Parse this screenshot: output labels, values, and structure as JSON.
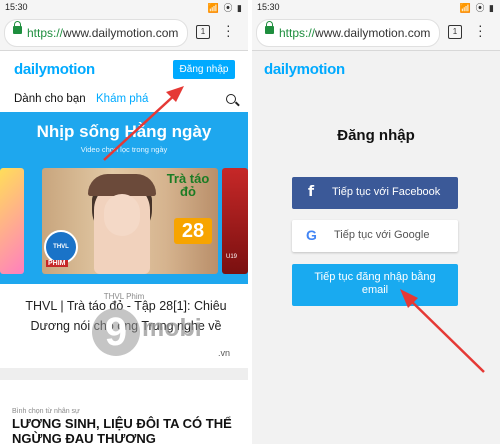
{
  "left": {
    "status": {
      "time": "15:30",
      "icons": "📶 ⦿ ▮"
    },
    "browser": {
      "url_proto": "https://",
      "url_rest": "www.dailymotion.com",
      "tab_count": "1"
    },
    "header": {
      "logo": "dailymotion",
      "login_label": "Đăng nhập"
    },
    "tabs": [
      "Dành cho bạn",
      "Khám phá"
    ],
    "hero": {
      "title": "Nhịp sống Hằng ngày",
      "subtitle": "Video chọn lọc trong ngày",
      "card_badge": "Trà táo đỏ",
      "card_number": "28",
      "channel_logo": "THVL",
      "channel_label": "PHIM",
      "side_label": "U19"
    },
    "video": {
      "channel": "THVL Phim",
      "title": "THVL | Trà táo đỏ - Tập 28[1]: Chiêu Dương nói cho ông Trung nghe về"
    },
    "article": {
      "category": "Bình chọn từ nhân sự",
      "title": "LƯƠNG SINH, LIỆU ĐÔI TA CÓ THỂ NGỪNG ĐAU THƯƠNG"
    },
    "watermark": {
      "digit": "9",
      "text": "mobi",
      "suffix": ".vn"
    }
  },
  "right": {
    "status": {
      "time": "15:30",
      "icons": "📶 ⦿ ▮"
    },
    "browser": {
      "url_proto": "https://",
      "url_rest": "www.dailymotion.com",
      "tab_count": "1"
    },
    "header": {
      "logo": "dailymotion"
    },
    "login": {
      "title": "Đăng nhập",
      "facebook_icon": "f",
      "facebook": "Tiếp tục với Facebook",
      "google_icon": "G",
      "google": "Tiếp tục với Google",
      "email": "Tiếp tục đăng nhập bằng email"
    }
  },
  "colors": {
    "brand": "#00aaff",
    "facebook": "#3b5998",
    "email_button": "#19aaf0",
    "arrow": "#e53935"
  },
  "icons": [
    "lock-icon",
    "tab-switcher-icon",
    "menu-icon",
    "search-icon",
    "facebook-icon",
    "google-icon",
    "arrow-annotation"
  ]
}
